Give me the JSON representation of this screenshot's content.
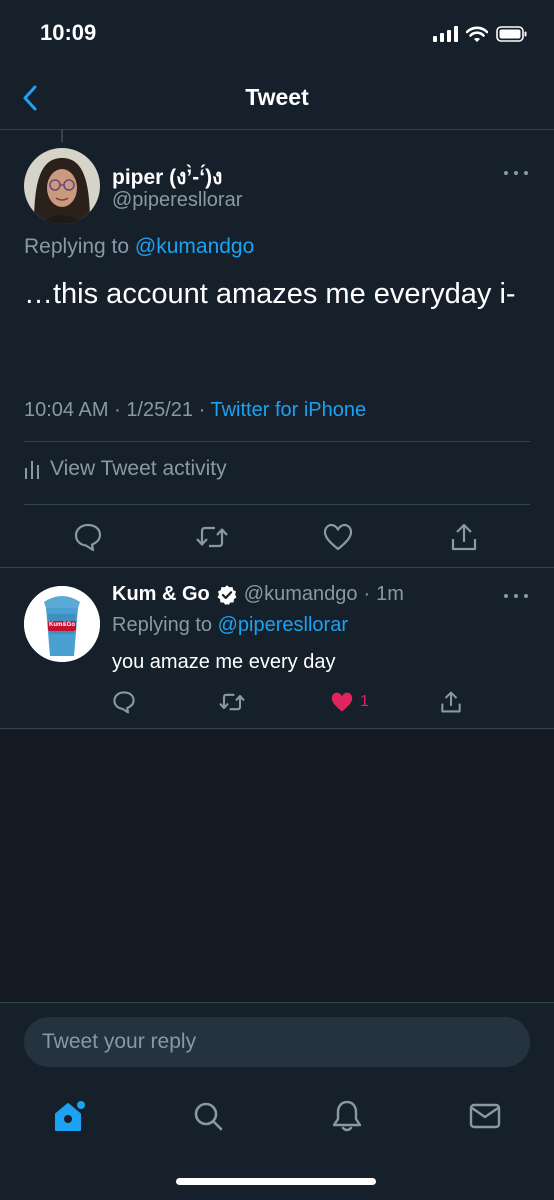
{
  "status_bar": {
    "time": "10:09"
  },
  "header": {
    "title": "Tweet"
  },
  "main_tweet": {
    "author_name": "piper (ง’̀-‘́)ง",
    "author_handle": "@piperesllorar",
    "replying_prefix": "Replying to ",
    "replying_handle": "@kumandgo",
    "text": "…this account amazes me everyday i-",
    "time": "10:04 AM",
    "date": "1/25/21",
    "separator": "·",
    "source": "Twitter for iPhone",
    "activity_label": "View Tweet activity"
  },
  "reply": {
    "author_name": "Kum & Go",
    "author_handle": "@kumandgo",
    "separator": "·",
    "time_ago": "1m",
    "replying_prefix": "Replying to ",
    "replying_handle": "@piperesllorar",
    "text": "you amaze me every day",
    "like_count": "1",
    "avatar_logo_text": "Kum&Go"
  },
  "composer": {
    "placeholder": "Tweet your reply"
  },
  "colors": {
    "background": "#15202b",
    "accent": "#1da1f2",
    "muted": "#8899a6",
    "like": "#e0245e",
    "border": "#38444d"
  },
  "icons": {
    "back": "chevron-left-icon",
    "reply": "comment-icon",
    "retweet": "retweet-icon",
    "like": "heart-icon",
    "share": "share-icon",
    "activity": "bar-chart-icon",
    "verified": "verified-badge-icon",
    "home": "home-icon",
    "search": "search-icon",
    "notifications": "bell-icon",
    "messages": "mail-icon"
  }
}
